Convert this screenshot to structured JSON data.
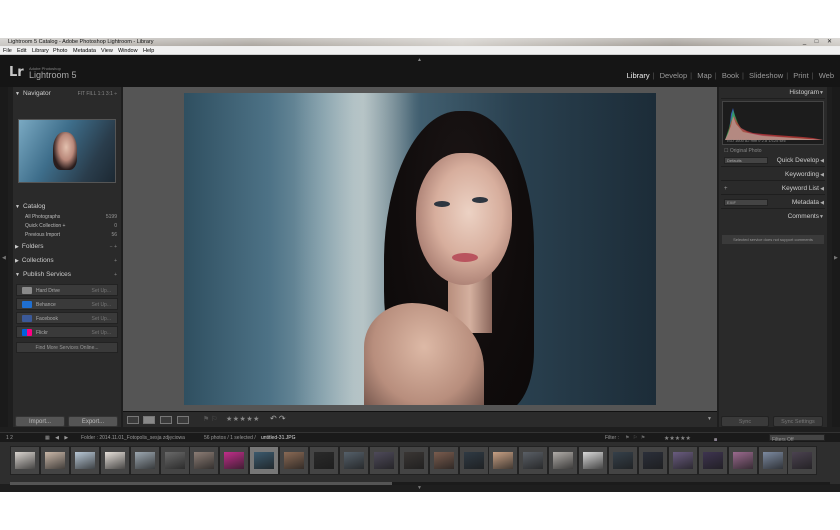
{
  "window": {
    "title": "Lightroom 5 Catalog - Adobe Photoshop Lightroom - Library",
    "controls": [
      "_",
      "□",
      "✕"
    ]
  },
  "menubar": [
    "File",
    "Edit",
    "Library",
    "Photo",
    "Metadata",
    "View",
    "Window",
    "Help"
  ],
  "identity": {
    "badge": "Lr",
    "vendor": "Adobe Photoshop",
    "product": "Lightroom 5"
  },
  "modules": {
    "items": [
      "Library",
      "Develop",
      "Map",
      "Book",
      "Slideshow",
      "Print",
      "Web"
    ],
    "active": "Library",
    "separator": "|"
  },
  "left_panel": {
    "navigator": {
      "title": "Navigator",
      "zoom_options": "FIT  FILL  1:1  3:1 ÷"
    },
    "catalog": {
      "title": "Catalog",
      "rows": [
        {
          "label": "All Photographs",
          "count": "5199"
        },
        {
          "label": "Quick Collection +",
          "count": "0"
        },
        {
          "label": "Previous Import",
          "count": "56"
        }
      ]
    },
    "folders": {
      "title": "Folders",
      "actions": "− +"
    },
    "collections": {
      "title": "Collections",
      "actions": "+"
    },
    "publish_services": {
      "title": "Publish Services",
      "actions": "+",
      "services": [
        {
          "label": "Hard Drive",
          "setup": "Set Up...",
          "color": "#8a8a8a"
        },
        {
          "label": "Behance",
          "setup": "Set Up...",
          "color": "#1f6fd1"
        },
        {
          "label": "Facebook",
          "setup": "Set Up...",
          "color": "#3b5998"
        },
        {
          "label": "Flickr",
          "setup": "Set Up...",
          "color": "#ff0084"
        }
      ],
      "more": "Find More Services Online..."
    },
    "import_label": "Import...",
    "export_label": "Export..."
  },
  "toolbar": {
    "stars": "★★★★★",
    "flags": "⚑ ⚐",
    "rotate": "↶ ↷",
    "caret": "▼"
  },
  "right_panel": {
    "histogram": {
      "title": "Histogram",
      "readout": "ISO 1600    82 mm    f/ 2.8    1/125 sec",
      "original_photo": "Original Photo"
    },
    "quick_develop": {
      "title": "Quick Develop",
      "preset": "Defaults"
    },
    "keywording": {
      "title": "Keywording"
    },
    "keyword_list": {
      "title": "Keyword List",
      "action": "+"
    },
    "metadata": {
      "title": "Metadata",
      "preset": "EXIF"
    },
    "comments": {
      "title": "Comments",
      "note": "Selected service does not support comments"
    },
    "sync_label": "Sync",
    "sync_settings_label": "Sync Settings"
  },
  "filmstrip_bar": {
    "screens": "1  2",
    "source": "Folder : 2014.11.01_Fotopolis_sesja zdjęciowa",
    "count": "56 photos / 1 selected /",
    "filename": "untitled-31.JPG",
    "filter_label": "Filter :",
    "filter_value": "Filters Off"
  },
  "filmstrip": {
    "count": 27,
    "selected_index": 8
  }
}
